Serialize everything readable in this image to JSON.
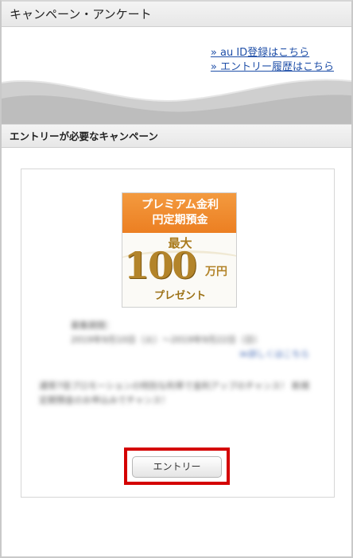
{
  "header": {
    "title": "キャンペーン・アンケート"
  },
  "links": [
    {
      "label": "» au ID登録はこちら"
    },
    {
      "label": "» エントリー履歴はこちら"
    }
  ],
  "section": {
    "title": "エントリーが必要なキャンペーン"
  },
  "campaign": {
    "banner": {
      "line1": "プレミアム金利",
      "line2": "円定期預金",
      "max": "最大",
      "amount": "100",
      "unit": "万円",
      "present": "プレゼント"
    },
    "period_label": "募集期間：",
    "period_text": "2019年9月10日（火）〜2019年9月22日（日）",
    "detail_link": "≫詳しくはこちら",
    "description": "通常7倍プロモーションの特別な利率で金利アップのチャンス！ 新規定期預金のお申込みでチャンス！",
    "entry_button": "エントリー"
  }
}
